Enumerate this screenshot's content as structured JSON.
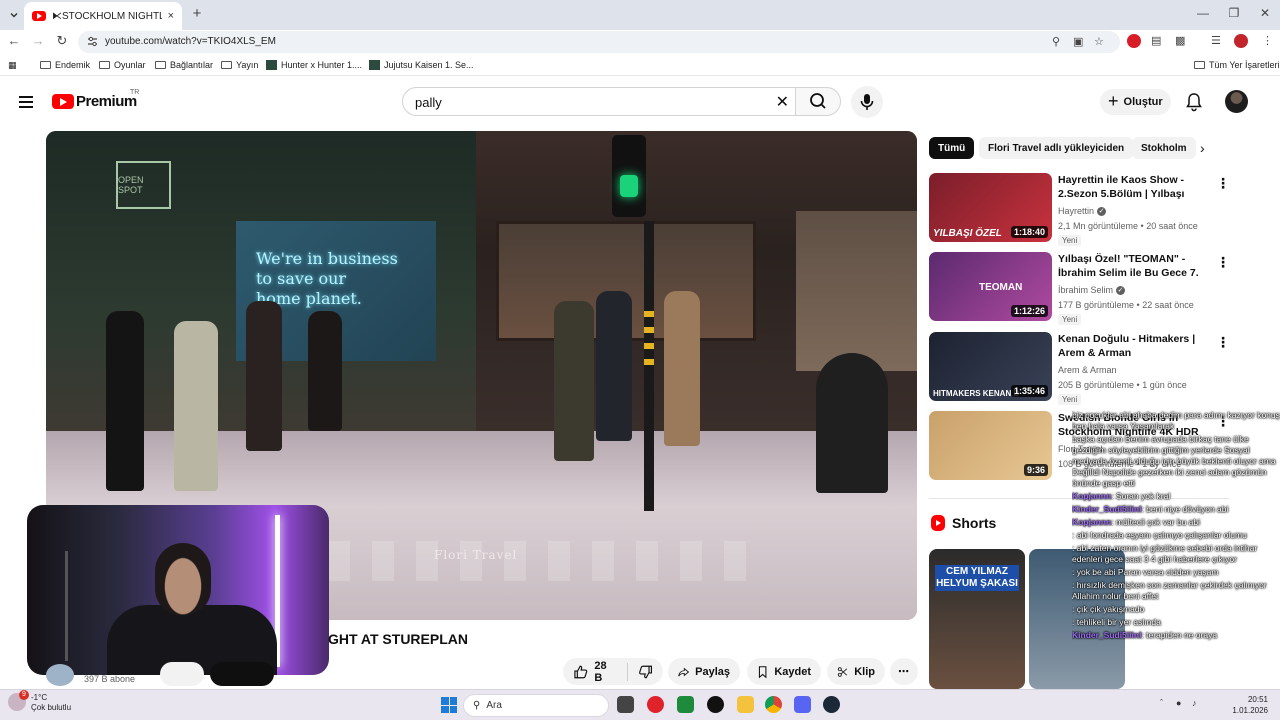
{
  "browser": {
    "tab_title": "⧔STOCKHOLM NIGHTLIFE 4K -",
    "tab_close": "×",
    "new_tab": "+",
    "url": "youtube.com/watch?v=TKIO4XLS_EM",
    "bookmarks": [
      {
        "label": "Endemik",
        "icon": "folder-icon"
      },
      {
        "label": "Oyunlar",
        "icon": "folder-icon"
      },
      {
        "label": "Bağlantılar",
        "icon": "folder-icon"
      },
      {
        "label": "Yayın",
        "icon": "folder-icon"
      },
      {
        "label": "Hunter x Hunter 1....",
        "icon": "bookmark-thumb-icon"
      },
      {
        "label": "Jujutsu Kaisen 1. Se...",
        "icon": "bookmark-thumb-icon"
      }
    ],
    "all_bookmarks": "Tüm Yer İşaretleri"
  },
  "masthead": {
    "brand": "Premium",
    "country": "TR",
    "search_value": "pally",
    "create_label": "Oluştur"
  },
  "video": {
    "watermark": "Flori Travel",
    "neon_lines": [
      "We're in business",
      "to save our",
      "home planet."
    ],
    "shop_sign": "OPEN SPOT",
    "title_visible": "GHT AT STUREPLAN",
    "subscribers": "397 B abone",
    "actions": {
      "likes": "28 B",
      "share": "Paylaş",
      "save": "Kaydet",
      "clip": "Klip"
    }
  },
  "sidebar": {
    "chips": [
      {
        "label": "Tümü",
        "active": true
      },
      {
        "label": "Flori Travel adlı yükleyiciden",
        "active": false
      },
      {
        "label": "Stokholm",
        "active": false
      }
    ],
    "recommendations": [
      {
        "title": "Hayrettin ile Kaos Show - 2.Sezon 5.Bölüm | Yılbaşı Özel...",
        "channel": "Hayrettin",
        "verified": true,
        "meta": "2,1 Mn görüntüleme • 20 saat önce",
        "badge": "Yeni",
        "duration": "1:18:40",
        "thumb_label": "YILBAŞI ÖZEL",
        "colors": [
          "#7a1e2a",
          "#c9323e"
        ]
      },
      {
        "title": "Yılbaşı Özel! \"TEOMAN\" - İbrahim Selim ile Bu Gece 7. ...",
        "channel": "İbrahim Selim",
        "verified": true,
        "meta": "177 B görüntüleme • 22 saat önce",
        "badge": "Yeni",
        "duration": "1:12:26",
        "thumb_label": "TEOMAN",
        "colors": [
          "#5b2a6e",
          "#b04aa0"
        ]
      },
      {
        "title": "Kenan Doğulu - Hitmakers | Arem & Arman",
        "channel": "Arem & Arman",
        "verified": false,
        "meta": "205 B görüntüleme • 1 gün önce",
        "badge": "Yeni",
        "duration": "1:35:46",
        "thumb_label": "HITMAKERS  KENAN D",
        "colors": [
          "#1c2230",
          "#3a4258"
        ]
      },
      {
        "title": "Swedish Blonde Girls In Stockholm Nightlife 4K HDR",
        "channel": "Flori Travel",
        "verified": false,
        "meta": "108 B görüntüleme • 1 ay önce",
        "badge": "",
        "duration": "9:36",
        "thumb_label": "",
        "colors": [
          "#c9a06a",
          "#e8c894"
        ]
      }
    ],
    "shorts_title": "Shorts",
    "shorts": [
      {
        "caption": "CEM YILMAZ HELYUM ŞAKASI",
        "colors": [
          "#2b2b2b",
          "#6a5040"
        ]
      },
      {
        "caption": "",
        "colors": [
          "#3e5a72",
          "#8a9aa8"
        ]
      }
    ]
  },
  "chat": [
    {
      "user": "",
      "text": "biz çocuklar abi ahaba dedim para adımı kazıyor konuş ben hala varsa Yaşamlarak"
    },
    {
      "user": "",
      "text": "başka açıdan Benim avrupada birkaç tane ülke gezdiğim söyleyebilirim gittiğim yerlerde Sosyal medyada özenli olduğu için büyük beklenti oluyor ama Değilldi Napolide gezerken iki zenci adam gözümün önünde gasp etti"
    },
    {
      "user": "Kopjannn",
      "text": ": Soran yok kral"
    },
    {
      "user": "Kinder_Sudi5ilinI",
      "text": ": beni niye dövüyon abi"
    },
    {
      "user": "Kopjannn",
      "text": ": mültecii çok var bu abi"
    },
    {
      "user": "",
      "text": ": abi londrada eşyanı çalınıyo çalışanlar olumu"
    },
    {
      "user": "",
      "text": ": abi zaten oranın iyi gözükme sebebi orda intihar edenleri gece saat 3 4 gibi haberlere çıkıyor"
    },
    {
      "user": "",
      "text": ": yok be abi Paran varsa cidden yaşam"
    },
    {
      "user": "",
      "text": ": hırsızlık demişken son zamanlar çekirdek çalınıyor Allahim nolur beni affet"
    },
    {
      "user": "",
      "text": ": çık çık yakışmado"
    },
    {
      "user": "",
      "text": ": tehlikeli bir yer aslında "
    },
    {
      "user": "Kinder_Sudi5ilinI",
      "text": ": terapiden ne oraya"
    }
  ],
  "taskbar": {
    "weather_badge": "9",
    "weather_temp": "-1°C",
    "weather_desc": "Çok bulutlu",
    "search_label": "Ara",
    "time": "20:51",
    "date": "1.01.2026"
  },
  "colors": {
    "youtube_red": "#ff0000",
    "chip_active": "#0f0f0f",
    "chat_user": "#9b6cf0",
    "neon": "#b8f2ff"
  }
}
